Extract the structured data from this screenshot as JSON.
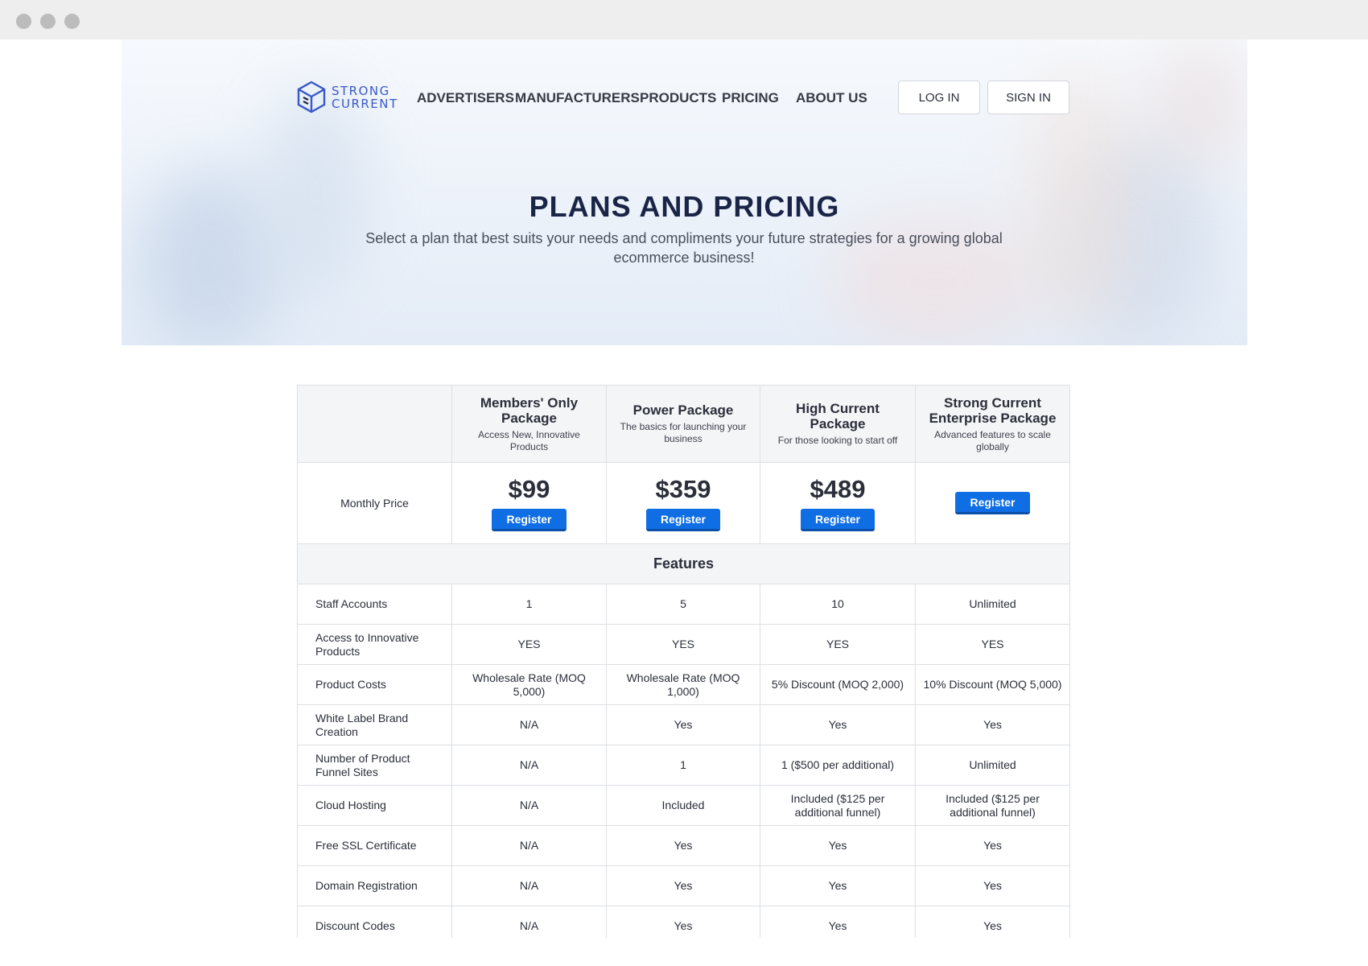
{
  "brand": {
    "line1": "STRONG",
    "line2": "CURRENT",
    "color": "#3a59c8"
  },
  "nav": [
    "ADVERTISERS",
    "MANUFACTURERS",
    "PRODUCTS",
    "PRICING",
    "ABOUT US"
  ],
  "auth": {
    "login": "LOG IN",
    "signin": "SIGN IN"
  },
  "hero": {
    "title": "PLANS AND PRICING",
    "subtitle": "Select a plan that best suits your needs and compliments your future strategies for a growing global ecommerce business!"
  },
  "packages": [
    {
      "name": "Members' Only Package",
      "desc": "Access New, Innovative Products",
      "price": "$99",
      "cta": "Register"
    },
    {
      "name": "Power Package",
      "desc": "The basics for launching your business",
      "price": "$359",
      "cta": "Register"
    },
    {
      "name": "High Current Package",
      "desc": "For those looking to start off",
      "price": "$489",
      "cta": "Register"
    },
    {
      "name": "Strong Current Enterprise Package",
      "desc": "Advanced features to scale globally",
      "price": "",
      "cta": "Register"
    }
  ],
  "price_row_label": "Monthly Price",
  "features_heading": "Features",
  "features": [
    {
      "label": "Staff Accounts",
      "values": [
        "1",
        "5",
        "10",
        "Unlimited"
      ]
    },
    {
      "label": "Access to Innovative Products",
      "values": [
        "YES",
        "YES",
        "YES",
        "YES"
      ]
    },
    {
      "label": "Product Costs",
      "values": [
        "Wholesale Rate (MOQ 5,000)",
        "Wholesale Rate (MOQ 1,000)",
        "5% Discount (MOQ 2,000)",
        "10% Discount (MOQ 5,000)"
      ]
    },
    {
      "label": "White Label Brand Creation",
      "values": [
        "N/A",
        "Yes",
        "Yes",
        "Yes"
      ]
    },
    {
      "label": "Number of Product Funnel Sites",
      "values": [
        "N/A",
        "1",
        "1 ($500 per additional)",
        "Unlimited"
      ]
    },
    {
      "label": "Cloud Hosting",
      "values": [
        "N/A",
        "Included",
        "Included ($125 per additional funnel)",
        "Included ($125 per additional funnel)"
      ]
    },
    {
      "label": "Free SSL Certificate",
      "values": [
        "N/A",
        "Yes",
        "Yes",
        "Yes"
      ]
    },
    {
      "label": "Domain Registration",
      "values": [
        "N/A",
        "Yes",
        "Yes",
        "Yes"
      ]
    },
    {
      "label": "Discount Codes",
      "values": [
        "N/A",
        "Yes",
        "Yes",
        "Yes"
      ]
    }
  ],
  "colors": {
    "primary_button": "#0f6ee3",
    "heading": "#1a2447"
  }
}
